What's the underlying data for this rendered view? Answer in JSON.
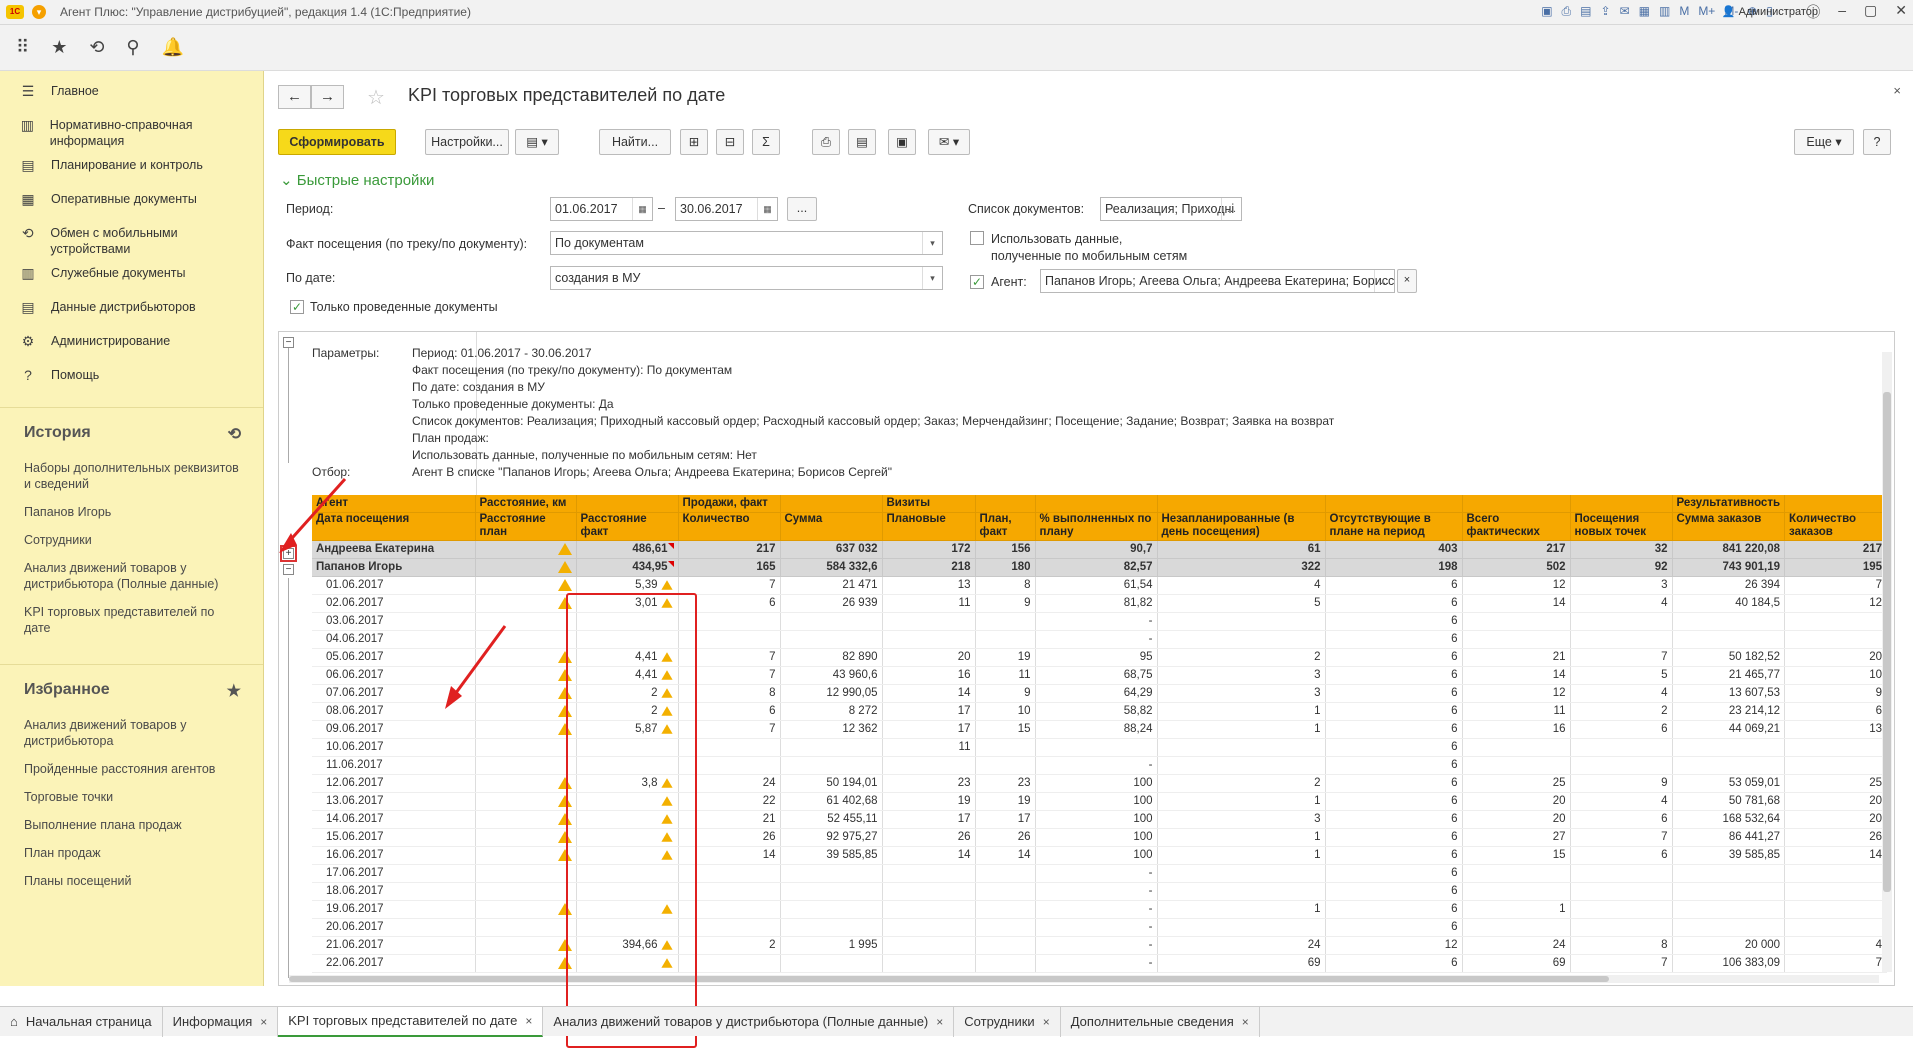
{
  "window": {
    "title": "Агент Плюс: \"Управление дистрибуцией\", редакция 1.4  (1С:Предприятие)",
    "user": "Администратор",
    "tools": [
      "M",
      "M+",
      "M-"
    ]
  },
  "sidebar": {
    "items": [
      {
        "label": "Главное",
        "icon": "☰"
      },
      {
        "label": "Нормативно-справочная информация",
        "icon": "▥"
      },
      {
        "label": "Планирование и контроль",
        "icon": "▤"
      },
      {
        "label": "Оперативные документы",
        "icon": "▦"
      },
      {
        "label": "Обмен с мобильными устройствами",
        "icon": "⟲"
      },
      {
        "label": "Служебные документы",
        "icon": "▥"
      },
      {
        "label": "Данные дистрибьюторов",
        "icon": "▤"
      },
      {
        "label": "Администрирование",
        "icon": "⚙"
      },
      {
        "label": "Помощь",
        "icon": "?"
      }
    ],
    "history_title": "История",
    "history": [
      "Наборы дополнительных реквизитов и сведений",
      "Папанов Игорь",
      "Сотрудники",
      "Анализ движений товаров у дистрибьютора (Полные данные)",
      "KPI торговых представителей по дате"
    ],
    "favorites_title": "Избранное",
    "favorites": [
      "Анализ движений товаров у дистрибьютора",
      "Пройденные расстояния агентов",
      "Торговые точки",
      "Выполнение плана продаж",
      "План продаж",
      "Планы посещений"
    ]
  },
  "form": {
    "title": "KPI торговых представителей по дате",
    "btn_generate": "Сформировать",
    "btn_settings": "Настройки...",
    "btn_find": "Найти...",
    "btn_more": "Еще",
    "btn_help": "?",
    "quick_settings": "Быстрые настройки",
    "period_label": "Период:",
    "date_from": "01.06.2017",
    "dash": "–",
    "date_to": "30.06.2017",
    "dots": "...",
    "fact_label": "Факт посещения (по треку/по документу):",
    "fact_value": "По документам",
    "bydate_label": "По дате:",
    "bydate_value": "создания в МУ",
    "posted_only": "Только проведенные документы",
    "doclist_label": "Список документов:",
    "doclist_value": "Реализация; Приходні",
    "use_mobile": "Использовать данные,",
    "use_mobile2": "полученные по мобильным сетям",
    "agent_label": "Агент:",
    "agent_value": "Папанов Игорь; Агеева Ольга; Андреева Екатерина; Борисс"
  },
  "params": {
    "head": "Параметры:",
    "filter_head": "Отбор:",
    "lines": [
      "Период: 01.06.2017 - 30.06.2017",
      "Факт посещения (по треку/по документу): По документам",
      "По дате: создания в МУ",
      "Только проведенные документы: Да",
      "Список документов: Реализация; Приходный кассовый ордер; Расходный кассовый ордер; Заказ; Мерчендайзинг; Посещение; Задание; Возврат; Заявка на возврат",
      "План продаж:",
      "Использовать данные, полученные по мобильным сетям: Нет"
    ],
    "filter": "Агент В списке \"Папанов Игорь; Агеева Ольга; Андреева Екатерина; Борисов Сергей\""
  },
  "table": {
    "head1": [
      "Агент",
      "Расстояние, км",
      "",
      "Продажи, факт",
      "",
      "Визиты",
      "",
      "",
      "",
      "",
      "",
      "",
      "Результативность",
      ""
    ],
    "head2": [
      "Дата посещения",
      "Расстояние план",
      "Расстояние факт",
      "Количество",
      "Сумма",
      "Плановые",
      "План, факт",
      "% выполненных по плану",
      "Незапланированные (в день посещения)",
      "Отсутствующие в плане на период",
      "Всего фактических",
      "Посещения новых точек",
      "Сумма заказов",
      "Количество заказов"
    ],
    "groups": [
      {
        "name": "Андреева Екатерина",
        "cells": [
          "",
          "486,61",
          "217",
          "637 032",
          "172",
          "156",
          "90,7",
          "61",
          "403",
          "217",
          "32",
          "841 220,08",
          "217"
        ]
      },
      {
        "name": "Папанов Игорь",
        "cells": [
          "",
          "434,95",
          "165",
          "584 332,6",
          "218",
          "180",
          "82,57",
          "322",
          "198",
          "502",
          "92",
          "743 901,19",
          "195"
        ]
      }
    ],
    "rows": [
      [
        "01.06.2017",
        "w",
        "5,39",
        "7",
        "21 471",
        "13",
        "8",
        "61,54",
        "4",
        "6",
        "12",
        "3",
        "26 394",
        "7"
      ],
      [
        "02.06.2017",
        "w",
        "3,01",
        "6",
        "26 939",
        "11",
        "9",
        "81,82",
        "5",
        "6",
        "14",
        "4",
        "40 184,5",
        "12"
      ],
      [
        "03.06.2017",
        "",
        "",
        "",
        "",
        "",
        "",
        "-",
        "",
        "6",
        "",
        "",
        "",
        ""
      ],
      [
        "04.06.2017",
        "",
        "",
        "",
        "",
        "",
        "",
        "-",
        "",
        "6",
        "",
        "",
        "",
        ""
      ],
      [
        "05.06.2017",
        "w",
        "4,41",
        "7",
        "82 890",
        "20",
        "19",
        "95",
        "2",
        "6",
        "21",
        "7",
        "50 182,52",
        "20"
      ],
      [
        "06.06.2017",
        "w",
        "4,41",
        "7",
        "43 960,6",
        "16",
        "11",
        "68,75",
        "3",
        "6",
        "14",
        "5",
        "21 465,77",
        "10"
      ],
      [
        "07.06.2017",
        "w",
        "2",
        "8",
        "12 990,05",
        "14",
        "9",
        "64,29",
        "3",
        "6",
        "12",
        "4",
        "13 607,53",
        "9"
      ],
      [
        "08.06.2017",
        "w",
        "2",
        "6",
        "8 272",
        "17",
        "10",
        "58,82",
        "1",
        "6",
        "11",
        "2",
        "23 214,12",
        "6"
      ],
      [
        "09.06.2017",
        "w",
        "5,87",
        "7",
        "12 362",
        "17",
        "15",
        "88,24",
        "1",
        "6",
        "16",
        "6",
        "44 069,21",
        "13"
      ],
      [
        "10.06.2017",
        "",
        "",
        "",
        "",
        "11",
        "",
        "",
        "",
        "6",
        "",
        "",
        "",
        ""
      ],
      [
        "11.06.2017",
        "",
        "",
        "",
        "",
        "",
        "",
        "-",
        "",
        "6",
        "",
        "",
        "",
        ""
      ],
      [
        "12.06.2017",
        "w",
        "3,8",
        "24",
        "50 194,01",
        "23",
        "23",
        "100",
        "2",
        "6",
        "25",
        "9",
        "53 059,01",
        "25"
      ],
      [
        "13.06.2017",
        "w",
        "",
        "22",
        "61 402,68",
        "19",
        "19",
        "100",
        "1",
        "6",
        "20",
        "4",
        "50 781,68",
        "20"
      ],
      [
        "14.06.2017",
        "w",
        "",
        "21",
        "52 455,11",
        "17",
        "17",
        "100",
        "3",
        "6",
        "20",
        "6",
        "168 532,64",
        "20"
      ],
      [
        "15.06.2017",
        "w",
        "",
        "26",
        "92 975,27",
        "26",
        "26",
        "100",
        "1",
        "6",
        "27",
        "7",
        "86 441,27",
        "26"
      ],
      [
        "16.06.2017",
        "w",
        "",
        "14",
        "39 585,85",
        "14",
        "14",
        "100",
        "1",
        "6",
        "15",
        "6",
        "39 585,85",
        "14"
      ],
      [
        "17.06.2017",
        "",
        "",
        "",
        "",
        "",
        "",
        "-",
        "",
        "6",
        "",
        "",
        "",
        ""
      ],
      [
        "18.06.2017",
        "",
        "",
        "",
        "",
        "",
        "",
        "-",
        "",
        "6",
        "",
        "",
        "",
        ""
      ],
      [
        "19.06.2017",
        "w",
        "",
        "",
        "",
        "",
        "",
        "-",
        "1",
        "6",
        "1",
        "",
        "",
        ""
      ],
      [
        "20.06.2017",
        "",
        "",
        "",
        "",
        "",
        "",
        "-",
        "",
        "6",
        "",
        "",
        "",
        ""
      ],
      [
        "21.06.2017",
        "w",
        "394,66",
        "2",
        "1 995",
        "",
        "",
        "-",
        "24",
        "12",
        "24",
        "8",
        "20 000",
        "4"
      ],
      [
        "22.06.2017",
        "w",
        "",
        "",
        "",
        "",
        "",
        "-",
        "69",
        "6",
        "69",
        "7",
        "106 383,09",
        "7"
      ]
    ]
  },
  "tabs": [
    "Начальная страница",
    "Информация",
    "KPI торговых представителей по дате",
    "Анализ движений товаров у дистрибьютора (Полные данные)",
    "Сотрудники",
    "Дополнительные сведения"
  ]
}
